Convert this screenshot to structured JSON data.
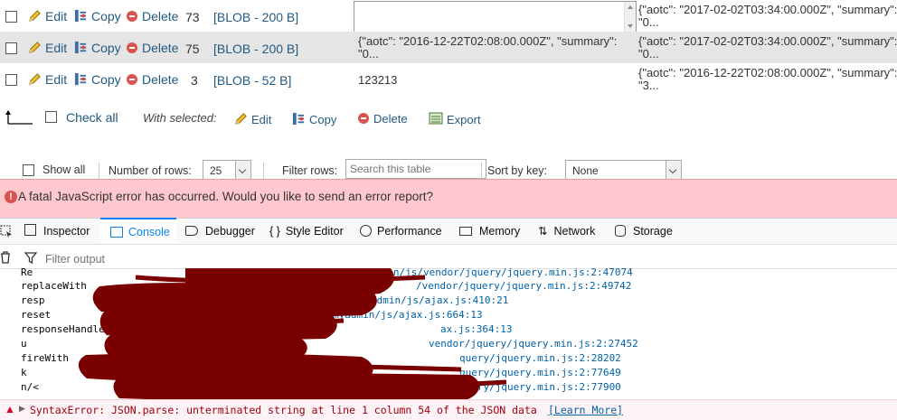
{
  "table": {
    "rows": [
      {
        "edit": "Edit",
        "copy": "Copy",
        "delete": "Delete",
        "id": "73",
        "blob": "[BLOB - 200 B]",
        "col3": "",
        "col4a": "{\"aotc\": \"2017-02-02T03:34:00.000Z\", \"summary\":",
        "col4b": "\"0..."
      },
      {
        "edit": "Edit",
        "copy": "Copy",
        "delete": "Delete",
        "id": "75",
        "blob": "[BLOB - 200 B]",
        "col3a": "{\"aotc\": \"2016-12-22T02:08:00.000Z\", \"summary\":",
        "col3b": "\"0...",
        "col4a": "{\"aotc\": \"2017-02-02T03:34:00.000Z\", \"summary\":",
        "col4b": "\"0..."
      },
      {
        "edit": "Edit",
        "copy": "Copy",
        "delete": "Delete",
        "id": "3",
        "blob": "[BLOB - 52 B]",
        "col3": "123213",
        "col4a": "{\"aotc\": \"2016-12-22T02:08:00.000Z\", \"summary\":",
        "col4b": "\"3..."
      }
    ]
  },
  "bulk": {
    "check_all": "Check all",
    "with_selected": "With selected:",
    "edit": "Edit",
    "copy": "Copy",
    "delete": "Delete",
    "export": "Export"
  },
  "nav": {
    "show_all": "Show all",
    "rows_label": "Number of rows:",
    "rows_value": "25",
    "filter_label": "Filter rows:",
    "filter_placeholder": "Search this table",
    "sort_label": "Sort by key:",
    "sort_value": "None"
  },
  "error_banner": {
    "text": "A fatal JavaScript error has occurred. Would you like to send an error report?"
  },
  "devtools": {
    "tabs": [
      "Inspector",
      "Console",
      "Debugger",
      "Style Editor",
      "Performance",
      "Memory",
      "Network",
      "Storage"
    ],
    "active_tab": "Console",
    "filter_placeholder": "Filter output",
    "log_lines": [
      {
        "fn": "Re",
        "url": "dmin/js/vendor/jquery/jquery.min.js:2:47074"
      },
      {
        "fn": "replaceWith",
        "url": "/vendor/jquery/jquery.min.js:2:49742"
      },
      {
        "fn": "resp",
        "url": "admin/js/ajax.js:410:21"
      },
      {
        "fn": "reset",
        "url": "myadmin/js/ajax.js:664:13"
      },
      {
        "fn": "responseHandle",
        "url": "ax.js:364:13"
      },
      {
        "fn": "u",
        "url": "vendor/jquery/jquery.min.js:2:27452"
      },
      {
        "fn": "fireWith",
        "url": "query/jquery.min.js:2:28202"
      },
      {
        "fn": "k",
        "url": "query/jquery.min.js:2:77649"
      },
      {
        "fn": "n/<",
        "url": "query/jquery.min.js:2:77900"
      }
    ],
    "error_line": "SyntaxError: JSON.parse: unterminated string at line 1 column 54 of the JSON data",
    "learn_more": "[Learn More]"
  },
  "colors": {
    "link": "#235a81",
    "row_alt": "#e5e5e5",
    "error_bg": "#ffc8ce",
    "redaction": "#7a0000",
    "console_error": "#a4000f"
  }
}
